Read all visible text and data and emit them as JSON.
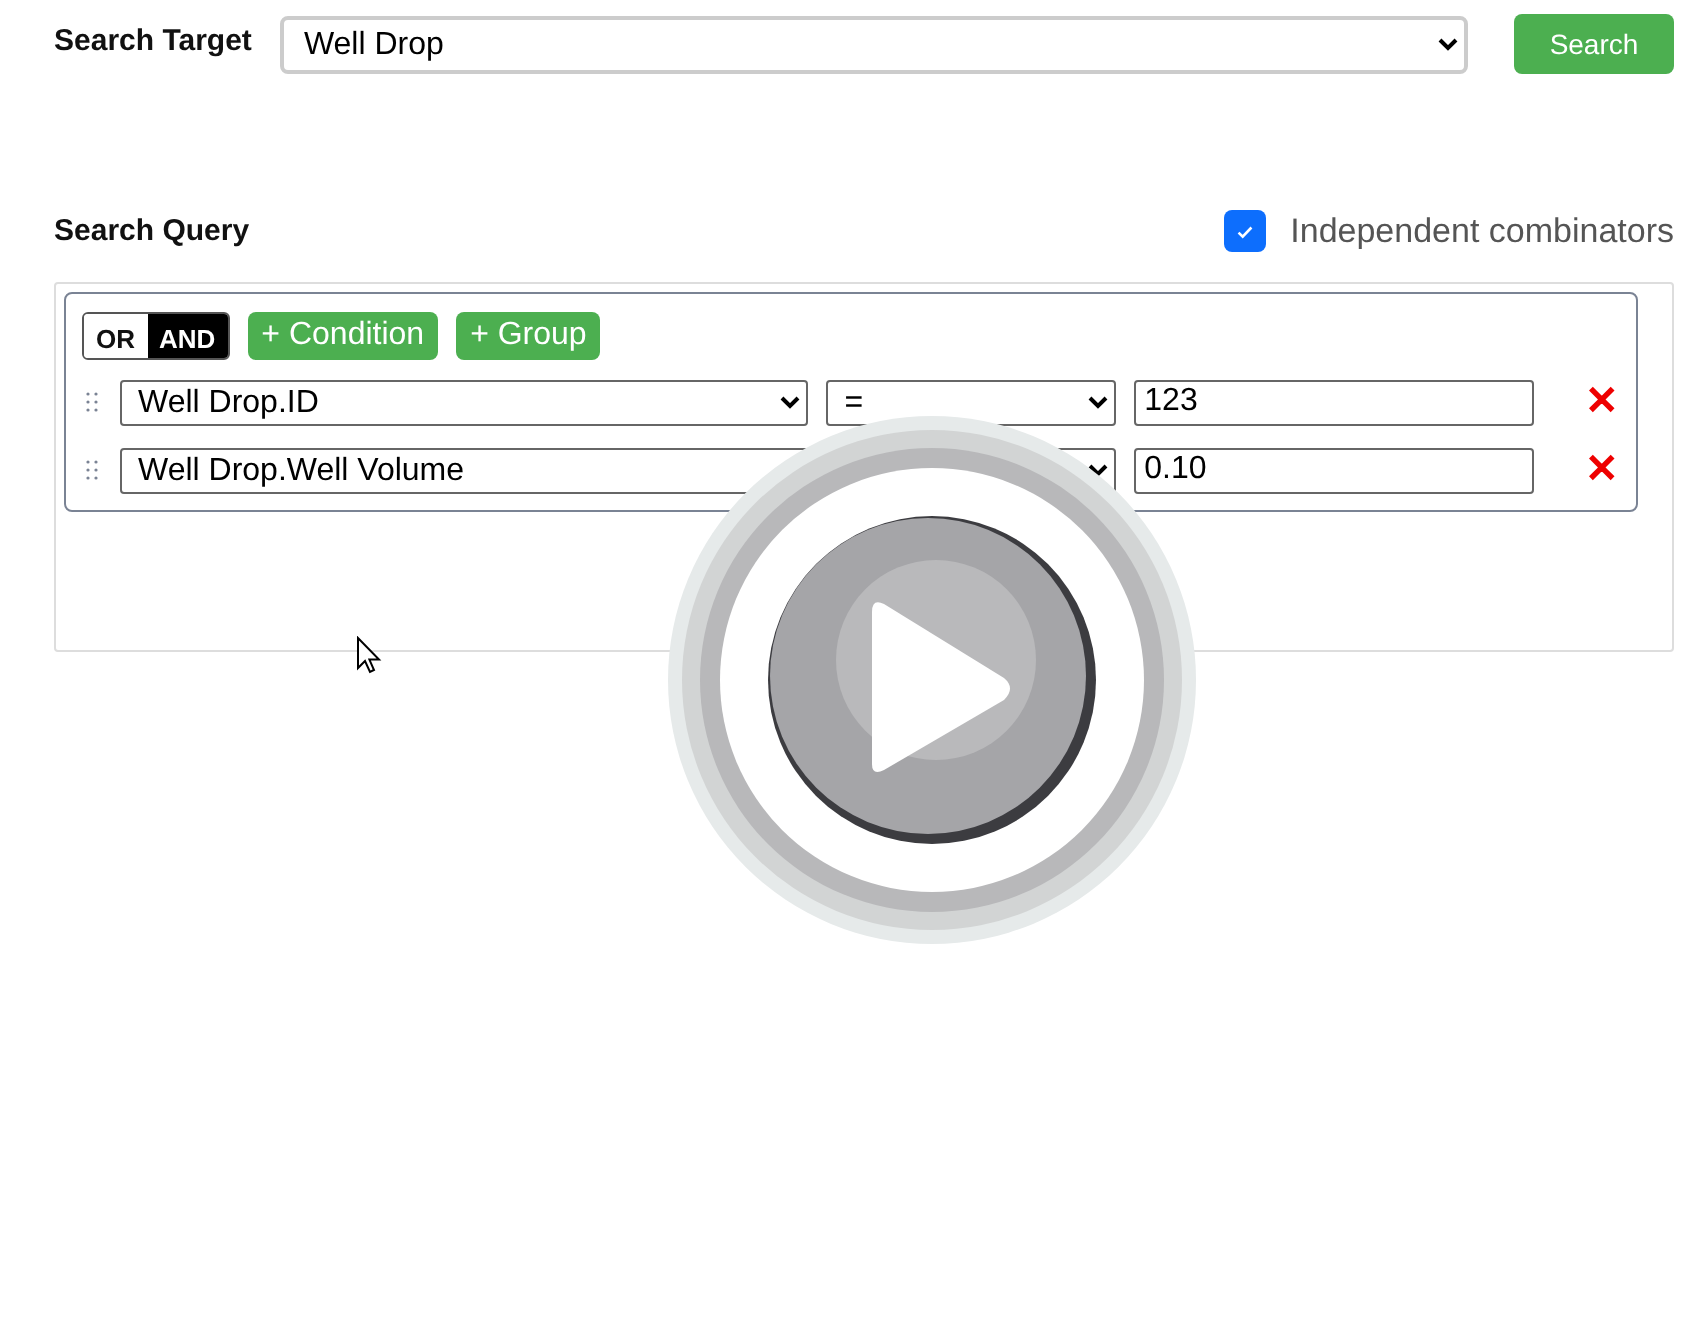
{
  "search_target": {
    "label": "Search Target",
    "value": "Well Drop",
    "button": "Search"
  },
  "search_query": {
    "label": "Search Query",
    "independent_combinators": {
      "label": "Independent combinators",
      "checked": true
    }
  },
  "group": {
    "combinators": [
      {
        "label": "OR",
        "selected": false
      },
      {
        "label": "AND",
        "selected": true
      }
    ],
    "actions": [
      "+ Condition",
      "+ Group"
    ],
    "rules": [
      {
        "field": "Well Drop.ID",
        "operator": "=",
        "value": "123"
      },
      {
        "field": "Well Drop.Well Volume",
        "value": "0.10"
      }
    ],
    "remove_symbol": "✕"
  },
  "video_overlay": {
    "kind": "play"
  }
}
